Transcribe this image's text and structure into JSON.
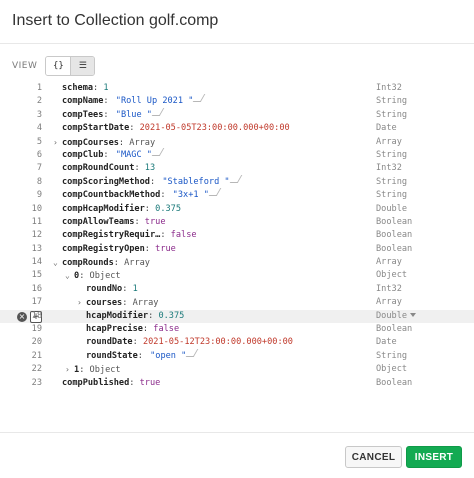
{
  "dialog": {
    "title": "Insert to Collection golf.comp"
  },
  "view": {
    "label": "VIEW",
    "json_button": "{}",
    "list_button": "☰"
  },
  "rows": [
    {
      "line": "1",
      "caret": "",
      "key": "schema",
      "val": "1",
      "vkind": "num",
      "type": "Int32"
    },
    {
      "line": "2",
      "caret": "",
      "key": "compName",
      "val": "\"Roll Up 2021 \"",
      "vkind": "str",
      "type": "String"
    },
    {
      "line": "3",
      "caret": "",
      "key": "compTees",
      "val": "\"Blue \"",
      "vkind": "str",
      "type": "String"
    },
    {
      "line": "4",
      "caret": "",
      "key": "compStartDate",
      "val": "2021-05-05T23:00:00.000+00:00",
      "vkind": "date",
      "type": "Date"
    },
    {
      "line": "5",
      "caret": ">",
      "key": "compCourses",
      "val": "Array",
      "vkind": "type",
      "type": "Array"
    },
    {
      "line": "6",
      "caret": "",
      "key": "compClub",
      "val": "\"MAGC \"",
      "vkind": "str",
      "type": "String"
    },
    {
      "line": "7",
      "caret": "",
      "key": "compRoundCount",
      "val": "13",
      "vkind": "num",
      "type": "Int32"
    },
    {
      "line": "8",
      "caret": "",
      "key": "compScoringMethod",
      "val": "\"Stableford \"",
      "vkind": "str",
      "type": "String"
    },
    {
      "line": "9",
      "caret": "",
      "key": "compCountbackMethod",
      "val": "\"3x+1 \"",
      "vkind": "str",
      "type": "String"
    },
    {
      "line": "10",
      "caret": "",
      "key": "compHcapModifier",
      "val": "0.375",
      "vkind": "num",
      "type": "Double"
    },
    {
      "line": "11",
      "caret": "",
      "key": "compAllowTeams",
      "val": "true",
      "vkind": "bool",
      "type": "Boolean"
    },
    {
      "line": "12",
      "caret": "",
      "key": "compRegistryRequir…",
      "val": "false",
      "vkind": "bool",
      "type": "Boolean"
    },
    {
      "line": "13",
      "caret": "",
      "key": "compRegistryOpen",
      "val": "true",
      "vkind": "bool",
      "type": "Boolean"
    },
    {
      "line": "14",
      "caret": "v",
      "key": "compRounds",
      "val": "Array",
      "vkind": "type",
      "type": "Array"
    },
    {
      "line": "15",
      "caret": "v",
      "key": "0",
      "val": "Object",
      "vkind": "type",
      "type": "Object",
      "indent": 1
    },
    {
      "line": "16",
      "caret": "",
      "key": "roundNo",
      "val": "1",
      "vkind": "num",
      "type": "Int32",
      "indent": 2
    },
    {
      "line": "17",
      "caret": ">",
      "key": "courses",
      "val": "Array",
      "vkind": "type",
      "type": "Array",
      "indent": 2
    },
    {
      "line": "18",
      "caret": "",
      "key": "hcapModifier",
      "val": "0.375",
      "vkind": "num",
      "type": "Double",
      "indent": 2,
      "active": true
    },
    {
      "line": "19",
      "caret": "",
      "key": "hcapPrecise",
      "val": "false",
      "vkind": "bool",
      "type": "Boolean",
      "indent": 2
    },
    {
      "line": "20",
      "caret": "",
      "key": "roundDate",
      "val": "2021-05-12T23:00:00.000+00:00",
      "vkind": "date",
      "type": "Date",
      "indent": 2
    },
    {
      "line": "21",
      "caret": "",
      "key": "roundState",
      "val": "\"open \"",
      "vkind": "str",
      "type": "String",
      "indent": 2
    },
    {
      "line": "22",
      "caret": ">",
      "key": "1",
      "val": "Object",
      "vkind": "type",
      "type": "Object",
      "indent": 1
    },
    {
      "line": "23",
      "caret": "",
      "key": "compPublished",
      "val": "true",
      "vkind": "bool",
      "type": "Boolean"
    }
  ],
  "row_controls": {
    "remove_symbol": "×",
    "add_symbol": "+"
  },
  "footer": {
    "cancel_label": "CANCEL",
    "insert_label": "INSERT"
  },
  "colors": {
    "insert_button": "#13aa52",
    "string": "#1a57c6",
    "date": "#c0392b",
    "number": "#1b7a7a",
    "boolean": "#8b2b8b"
  }
}
